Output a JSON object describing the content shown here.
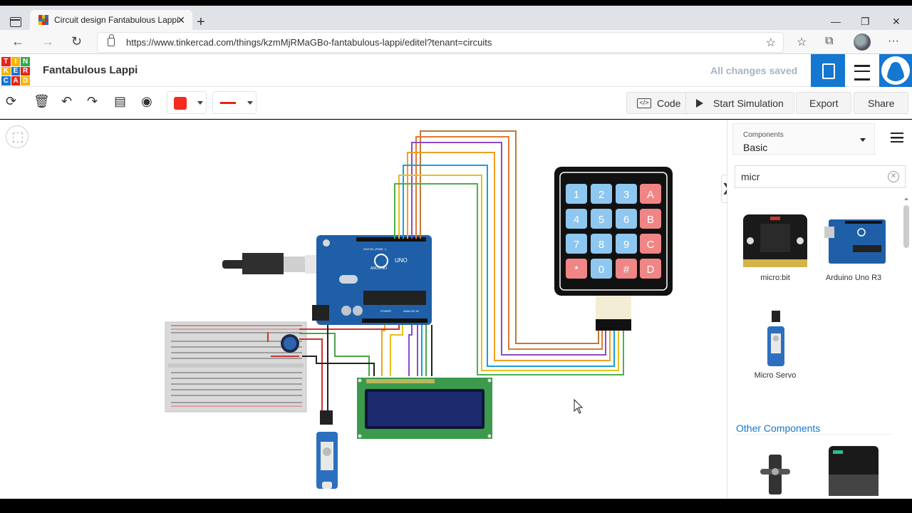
{
  "browser": {
    "tab_title": "Circuit design Fantabulous Lappi",
    "url": "https://www.tinkercad.com/things/kzmMjRMaGBo-fantabulous-lappi/editel?tenant=circuits"
  },
  "app": {
    "logo_letters": [
      "T",
      "I",
      "N",
      "K",
      "E",
      "R",
      "C",
      "A",
      "D"
    ],
    "design_title": "Fantabulous Lappi",
    "save_status": "All changes saved"
  },
  "toolbar": {
    "code_label": "Code",
    "code_icon_text": "</>",
    "simulate_label": "Start Simulation",
    "export_label": "Export",
    "share_label": "Share",
    "fill_color": "#f32b21",
    "wire_color": "#e8231a"
  },
  "sidebar": {
    "components_label": "Components",
    "components_value": "Basic",
    "search_value": "micr",
    "results": [
      {
        "label": "micro:bit"
      },
      {
        "label": "Arduino Uno R3"
      },
      {
        "label": "Micro Servo"
      }
    ],
    "other_heading": "Other Components"
  },
  "keypad": {
    "keys": [
      "1",
      "2",
      "3",
      "A",
      "4",
      "5",
      "6",
      "B",
      "7",
      "8",
      "9",
      "C",
      "*",
      "0",
      "#",
      "D"
    ]
  },
  "arduino": {
    "brand": "UNO",
    "maker": "ARDUINO",
    "digital_label": "DIGITAL (PWM ~)",
    "power_label": "POWER",
    "analog_label": "ANALOG IN"
  },
  "colors": {
    "accent": "#1477d1",
    "board_blue": "#1f5fa8",
    "breadboard": "#d9d9d9",
    "lcd_green": "#3b9a4c",
    "lcd_screen": "#1d2a6e"
  }
}
